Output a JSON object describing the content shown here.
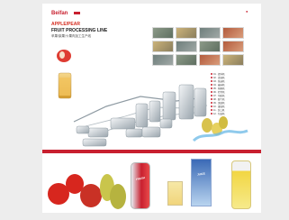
{
  "header": {
    "brand": "Beifan",
    "top_mark": "●",
    "title_line_1": "APPLE/PEAR",
    "title_line_2": "FRUIT PROCESSING LINE",
    "subtitle": "苹果/梨果汁/果肉加工生产线"
  },
  "legend": [
    "01 · 提升机",
    "02 · 清洗机",
    "03 · 拣选机",
    "04 · 破碎机",
    "05 · 预煮机",
    "06 · 打浆机",
    "07 · 均质机",
    "08 · 脱气机",
    "09 · 灭菌机",
    "10 · 灌装机",
    "11 · 封口机",
    "12 · 包装机"
  ],
  "products": {
    "can_label": "FRESH",
    "carton_label": "JUICE"
  },
  "colors": {
    "accent": "#c8202f",
    "background": "#ededed",
    "sheet": "#ffffff"
  }
}
